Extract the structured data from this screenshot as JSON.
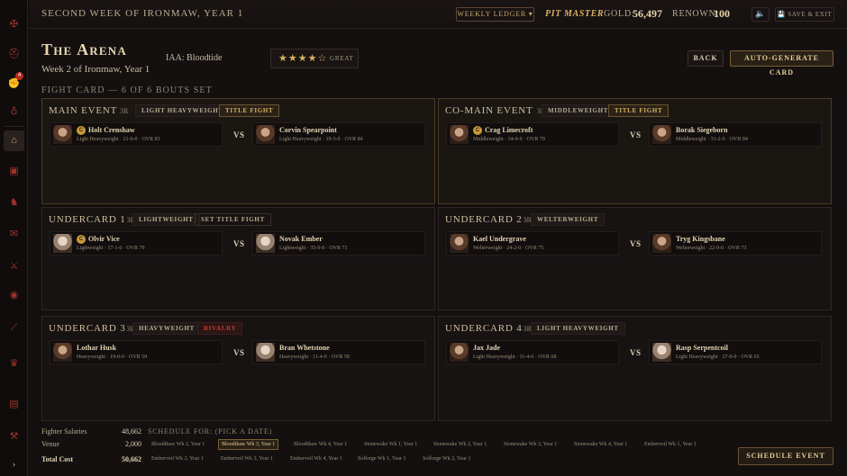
{
  "sidebar": {
    "icons": [
      "crest-icon",
      "helmet-icon",
      "fist-icon",
      "potion-icon",
      "arena-icon",
      "chest-icon",
      "fighter-icon",
      "scroll-icon",
      "sword-icon",
      "eye-icon",
      "blade-icon",
      "trophy-icon",
      "gate-icon",
      "axe-icon"
    ],
    "badge": "4",
    "expand": "›"
  },
  "topbar": {
    "title": "Second Week of Ironmaw, Year 1",
    "ledger": "Weekly Ledger ▾",
    "rank": "Pit Master",
    "gold_label": "Gold:",
    "gold": "56,497",
    "renown_label": "Renown:",
    "renown": "100",
    "sound": "🔈",
    "save_exit": "💾 Save & Exit"
  },
  "header": {
    "title": "The Arena",
    "subtitle": "Week 2 of Ironmaw, Year 1",
    "iaa": "IAA: Bloodtide",
    "stars": "★★★★☆",
    "rating": "Great",
    "back": "Back",
    "auto": "Auto-Generate Card",
    "card_heading": "Fight Card — 6 of 6 Bouts Set"
  },
  "bouts": [
    {
      "title": "Main Event",
      "rounds": "3R",
      "weight": "Light Heavyweight",
      "tag2": "Title Fight",
      "a": {
        "name": "Holt Crenshaw",
        "stats": "Light Heavyweight · 21-0-0 · OVR 83",
        "champ": "C"
      },
      "b": {
        "name": "Corvin Spearpoint",
        "stats": "Light Heavyweight · 19-3-0 · OVR 84"
      }
    },
    {
      "title": "Co-Main Event",
      "rounds": "3R",
      "weight": "Middleweight",
      "tag2": "Title Fight",
      "a": {
        "name": "Crag Limecroft",
        "stats": "Middleweight · 34-0-0 · OVR 79",
        "champ": "C"
      },
      "b": {
        "name": "Borak Siegeborn",
        "stats": "Middleweight · 31-2-0 · OVR 84"
      }
    },
    {
      "title": "Undercard 1",
      "rounds": "3R",
      "weight": "Lightweight",
      "tag2": "Set Title Fight",
      "a": {
        "name": "Olvir Vice",
        "stats": "Lightweight · 17-1-0 · OVR 79",
        "champ": "C"
      },
      "b": {
        "name": "Novak Ember",
        "stats": "Lightweight · 35-0-0 · OVR 71"
      }
    },
    {
      "title": "Undercard 2",
      "rounds": "3R",
      "weight": "Welterweight",
      "a": {
        "name": "Kael Undergrave",
        "stats": "Welterweight · 24-2-0 · OVR 75"
      },
      "b": {
        "name": "Tryg Kingsbane",
        "stats": "Welterweight · 22-0-0 · OVR 73"
      }
    },
    {
      "title": "Undercard 3",
      "rounds": "3R",
      "weight": "Heavyweight",
      "tag2": "Rivalry",
      "a": {
        "name": "Lothar Husk",
        "stats": "Heavyweight · 19-0-0 · OVR 59"
      },
      "b": {
        "name": "Bran Whetstone",
        "stats": "Heavyweight · 11-4-0 · OVR 58"
      }
    },
    {
      "title": "Undercard 4",
      "rounds": "3R",
      "weight": "Light Heavyweight",
      "a": {
        "name": "Jax Jade",
        "stats": "Light Heavyweight · 11-4-0 · OVR 68"
      },
      "b": {
        "name": "Rasp Serpentcoil",
        "stats": "Light Heavyweight · 27-0-0 · OVR 65"
      }
    }
  ],
  "vs": "VS",
  "footer": {
    "salaries_label": "Fighter Salaries",
    "salaries": "48,662",
    "venue_label": "Venue",
    "venue": "2,000",
    "total_label": "Total Cost",
    "total": "50,662",
    "schedule_label": "Schedule for: (pick a date)",
    "dates_row1": [
      "Bloodthaw Wk 2, Year 1",
      "Bloodthaw Wk 3, Year 1",
      "Bloodthaw Wk 4, Year 1",
      "Stonewake Wk 1, Year 1",
      "Stonewake Wk 2, Year 1",
      "Stonewake Wk 3, Year 1",
      "Stonewake Wk 4, Year 1",
      "Emberveil Wk 1, Year 1"
    ],
    "dates_row2": [
      "Emberveil Wk 2, Year 1",
      "Emberveil Wk 3, Year 1",
      "Emberveil Wk 4, Year 1",
      "Solforge Wk 1, Year 1",
      "Solforge Wk 2, Year 1"
    ],
    "selected_date": "Bloodthaw Wk 3, Year 1",
    "schedule_btn": "Schedule Event"
  }
}
